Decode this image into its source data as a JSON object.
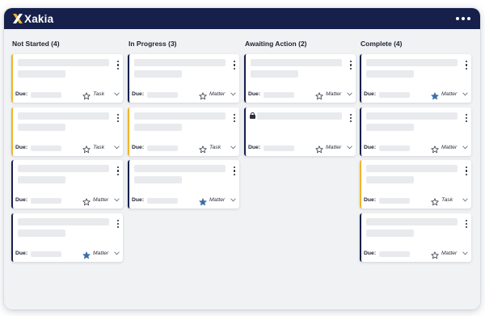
{
  "app": {
    "logo_text": "Xakia",
    "brand_color": "#16204a",
    "accent_task": "#f0b429",
    "star_active": "#3b6fa8"
  },
  "header": {
    "menu_icon": "more-horizontal-icon"
  },
  "columns": [
    {
      "title": "Not Started (4)",
      "cards": [
        {
          "kind": "task",
          "due_label": "Due:",
          "type": "Task",
          "starred": false,
          "locked": false
        },
        {
          "kind": "task",
          "due_label": "Due:",
          "type": "Task",
          "starred": false,
          "locked": false
        },
        {
          "kind": "matter",
          "due_label": "Due:",
          "type": "Matter",
          "starred": false,
          "locked": false
        },
        {
          "kind": "matter",
          "due_label": "Due:",
          "type": "Matter",
          "starred": true,
          "locked": false
        }
      ]
    },
    {
      "title": "In Progress (3)",
      "cards": [
        {
          "kind": "matter",
          "due_label": "Due:",
          "type": "Matter",
          "starred": false,
          "locked": false
        },
        {
          "kind": "task",
          "due_label": "Due:",
          "type": "Task",
          "starred": false,
          "locked": false
        },
        {
          "kind": "matter",
          "due_label": "Due:",
          "type": "Matter",
          "starred": true,
          "locked": false
        }
      ]
    },
    {
      "title": "Awaiting Action (2)",
      "cards": [
        {
          "kind": "matter",
          "due_label": "Due:",
          "type": "Matter",
          "starred": false,
          "locked": false
        },
        {
          "kind": "matter",
          "due_label": "Due:",
          "type": "Matter",
          "starred": false,
          "locked": true
        }
      ]
    },
    {
      "title": "Complete (4)",
      "cards": [
        {
          "kind": "matter",
          "due_label": "Due:",
          "type": "Matter",
          "starred": true,
          "locked": false
        },
        {
          "kind": "matter",
          "due_label": "Due:",
          "type": "Matter",
          "starred": false,
          "locked": false
        },
        {
          "kind": "task",
          "due_label": "Due:",
          "type": "Task",
          "starred": false,
          "locked": false
        },
        {
          "kind": "matter",
          "due_label": "Due:",
          "type": "Matter",
          "starred": false,
          "locked": false
        }
      ]
    }
  ]
}
